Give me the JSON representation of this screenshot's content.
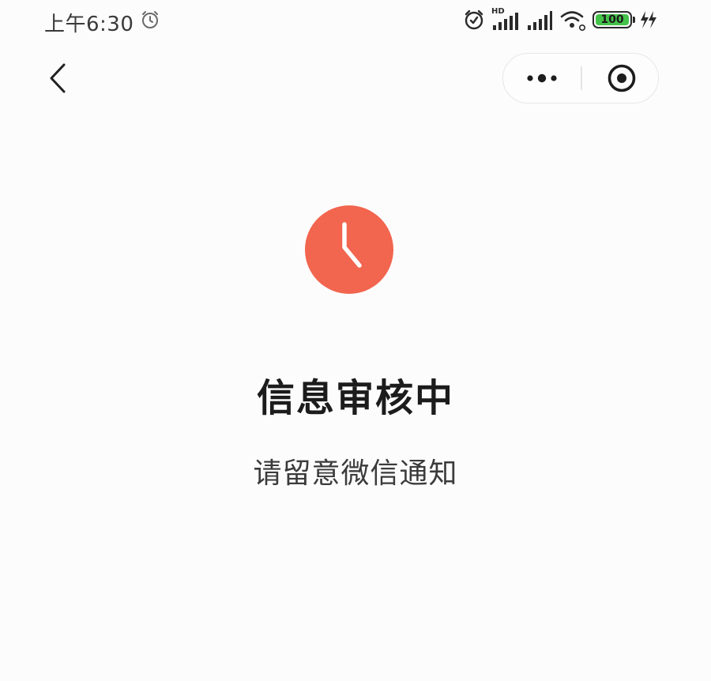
{
  "status_bar": {
    "time": "上午6:30",
    "network_badge": "HD",
    "battery_level": "100",
    "battery_percent": 100,
    "battery_color": "#44c24a"
  },
  "nav": {
    "back_icon": "chevron-left-icon",
    "more_icon": "more-dots-icon",
    "close_icon": "target-close-icon"
  },
  "status": {
    "icon": "clock-icon",
    "icon_color": "#f2654e",
    "title": "信息审核中",
    "subtitle": "请留意微信通知"
  }
}
